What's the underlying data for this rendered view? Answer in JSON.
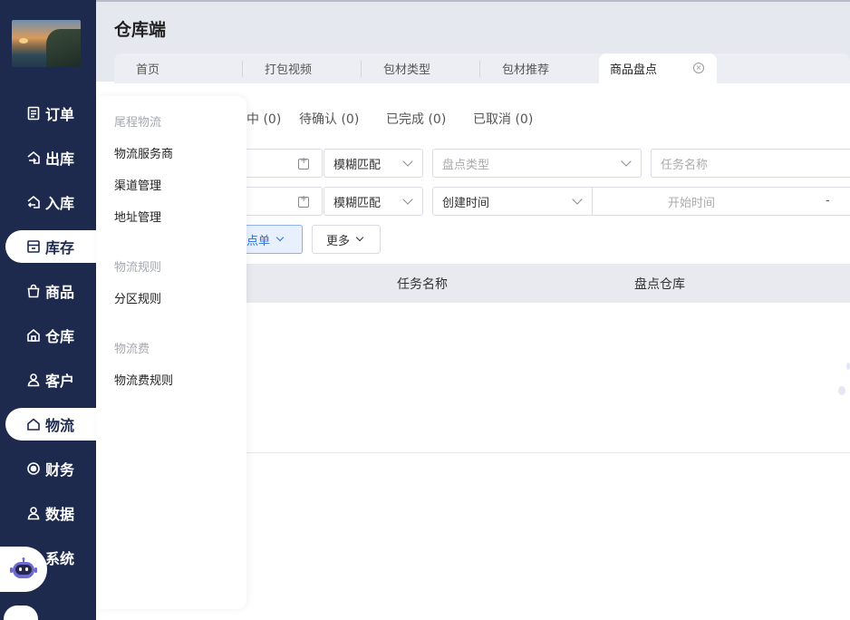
{
  "app": {
    "title": "仓库端"
  },
  "sidebar": {
    "items": [
      {
        "label": "订单",
        "icon": "order-icon",
        "active": false
      },
      {
        "label": "出库",
        "icon": "outbound-icon",
        "active": false
      },
      {
        "label": "入库",
        "icon": "inbound-icon",
        "active": false
      },
      {
        "label": "库存",
        "icon": "inventory-icon",
        "active": true
      },
      {
        "label": "商品",
        "icon": "bag-icon",
        "active": false
      },
      {
        "label": "仓库",
        "icon": "warehouse-icon",
        "active": false
      },
      {
        "label": "客户",
        "icon": "user-icon",
        "active": false
      },
      {
        "label": "物流",
        "icon": "home-icon",
        "active": true
      },
      {
        "label": "财务",
        "icon": "finance-icon",
        "active": false
      },
      {
        "label": "数据",
        "icon": "data-icon",
        "active": false
      },
      {
        "label": "系统",
        "icon": "system-icon",
        "active": false
      }
    ]
  },
  "tabs": [
    {
      "label": "首页"
    },
    {
      "label": "打包视频"
    },
    {
      "label": "包材类型"
    },
    {
      "label": "包材推荐"
    },
    {
      "label": "商品盘点",
      "active": true
    }
  ],
  "status_tabs": [
    {
      "label": "中 (0)"
    },
    {
      "label": "待确认 (0)"
    },
    {
      "label": "已完成 (0)"
    },
    {
      "label": "已取消 (0)"
    }
  ],
  "filters": {
    "match_1": "模糊匹配",
    "check_type_placeholder": "盘点类型",
    "task_name_placeholder": "任务名称",
    "match_2": "模糊匹配",
    "time_type": "创建时间",
    "start_time_placeholder": "开始时间",
    "range_sep": "-"
  },
  "actions": {
    "primary": "点单",
    "more": "更多"
  },
  "table": {
    "columns": [
      "任务名称",
      "盘点仓库"
    ]
  },
  "flyout": {
    "groups": [
      {
        "title": "尾程物流",
        "items": [
          "物流服务商",
          "渠道管理",
          "地址管理"
        ]
      },
      {
        "title": "物流规则",
        "items": [
          "分区规则"
        ]
      },
      {
        "title": "物流费",
        "items": [
          "物流费规则"
        ]
      }
    ]
  },
  "colors": {
    "sidebar_bg": "#1e2a4d",
    "accent_blue": "#2f6fe0"
  }
}
